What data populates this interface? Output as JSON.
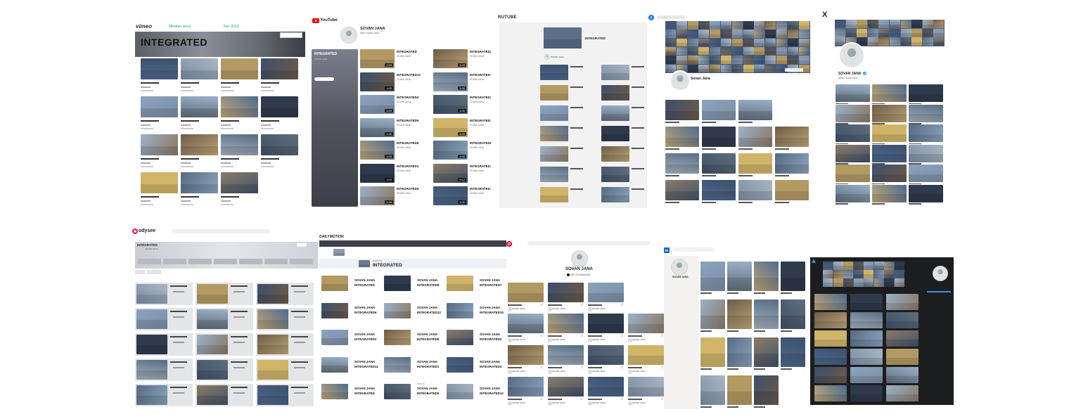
{
  "vimeo": {
    "brand": "vimeo",
    "member_label": "Member since",
    "member_date": "Nov 2013",
    "banner_title": "INTEGRATED"
  },
  "youtube": {
    "brand": "YouTube",
    "channel_name": "SOVAN JANA",
    "handle": "@mr.Sovan.Jana",
    "playlist_title": "INTEGRATED",
    "playlist_owner": "SOVAN JANA",
    "channel_label": "SOVAN JANA",
    "left_titles": [
      "INTEGRATED",
      "INTEGRATED12",
      "INTEGRATED4",
      "INTEGRATED9",
      "INTEGRATED8",
      "INTEGRATED1",
      "INTEGRATED5"
    ],
    "left_durations": [
      "1:00",
      "1:03",
      "1:00",
      "1:02",
      "1:05",
      "1:00",
      "1:05"
    ],
    "right_titles": [
      "INTEGRATED2",
      "INTEGRATED7",
      "INTEGRATED3",
      "INTEGRATED11",
      "INTEGRATED6",
      "INTEGRATED12",
      "INTEGRATED10"
    ],
    "right_durations": [
      "1:03",
      "1:05",
      "1:02",
      "1:02",
      "1:02",
      "0:12",
      "1:02"
    ]
  },
  "rutube": {
    "brand": "RUTUBE",
    "playlist_title": "INTEGRATED",
    "owner": "SOVAN JANA"
  },
  "facebook": {
    "brand": "f",
    "profile_name": "Sovan Jana"
  },
  "x": {
    "brand": "X",
    "profile_name": "SOVAN JANA",
    "handle": "@Mr_SovanJana"
  },
  "odysee": {
    "brand": "odysee",
    "channel_title": "INTEGRATED",
    "channel_owner": "SOVAN JANA"
  },
  "dailymotion": {
    "brand": "DAILYMOTION",
    "playlist_label": "PLAYLIST",
    "playlist_title": "INTEGRATED",
    "col1": [
      [
        "SOVAN JANA",
        "INTEGRATED"
      ],
      [
        "SOVAN JANA",
        "INTEGRATED6"
      ],
      [
        "SOVAN JANA",
        "INTEGRATED2"
      ],
      [
        "SOVAN JANA",
        "INTEGRATED11"
      ],
      [
        "SOVAN JANA",
        "INTEGRATED"
      ]
    ],
    "col2": [
      [
        "SOVAN JANA",
        "INTEGRATED9"
      ],
      [
        "SOVAN JANA",
        "INTEGRATED12"
      ],
      [
        "SOVAN JANA",
        "INTEGRATED8"
      ],
      [
        "SOVAN JANA",
        "INTEGRATED1"
      ],
      [
        "SOVAN JANA",
        "INTEGRATED5"
      ]
    ],
    "col3": [
      [
        "SOVAN JANA",
        "INTEGRATED7"
      ],
      [
        "SOVAN JANA",
        "INTEGRATED10"
      ],
      [
        "SOVAN JANA",
        "INTEGRATED3"
      ],
      [
        "SOVAN JANA",
        "INTEGRATED4"
      ],
      [
        "SOVAN JANA",
        "INTEGRATED12"
      ]
    ],
    "col2_last_tag": "PUBLIC"
  },
  "pinterest": {
    "brand": "P",
    "profile_name": "SOVAN JANA",
    "handle": "MR_SOVANJANA",
    "pin_owner": "SOVAN JANA"
  },
  "linkedin": {
    "brand": "in",
    "profile_name": "SOVAN JANA"
  },
  "colors": {
    "youtube_red": "#ff0000",
    "facebook_blue": "#1877f2",
    "linkedin_blue": "#0a66c2",
    "pinterest_red": "#e60023",
    "odysee_pink": "#ef1970",
    "youtube_sidebar": "#5b5d6a",
    "dark_panel": "#1c1d1f"
  }
}
